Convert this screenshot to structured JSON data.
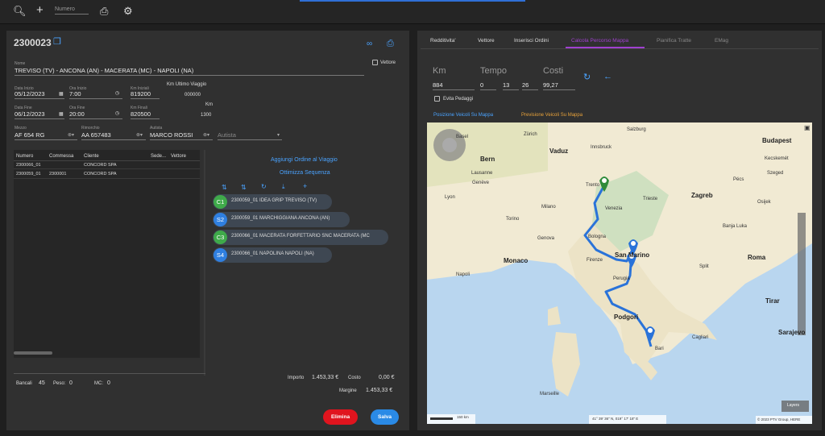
{
  "toolbar": {
    "search_icon": "search-icon",
    "add_icon": "plus-icon",
    "numero_placeholder": "Numero",
    "print_icon": "printer-icon",
    "settings_icon": "gear-icon"
  },
  "order": {
    "number": "2300023",
    "nome_label": "Nome",
    "nome_value": "TREVISO (TV) - ANCONA (AN) - MACERATA (MC) - NAPOLI (NA)",
    "vettore_label": "Vettore",
    "data_inizio_label": "Data Inizio",
    "data_inizio": "05/12/2023",
    "ora_inizio_label": "Ora Inizio",
    "ora_inizio": "7:00",
    "km_iniziali_label": "Km Iniziali",
    "km_iniziali": "819200",
    "km_ultimo_label": "Km Ultimo Viaggio",
    "km_ultimo": "000000",
    "data_fine_label": "Data Fine",
    "data_fine": "06/12/2023",
    "ora_fine_label": "Ora Fine",
    "ora_fine": "20:00",
    "km_finali_label": "Km Finali",
    "km_finali": "820500",
    "km_label": "Km",
    "km_value": "1300",
    "mezzo_label": "Mezzo",
    "mezzo": "AF 654 RG",
    "rimorchio_label": "Rimorchio",
    "rimorchio": "AA 657483",
    "autista_label": "Autista",
    "autista": "MARCO ROSSI",
    "autista2_placeholder": "Autista"
  },
  "table": {
    "headers": [
      "Numero",
      "Commessa",
      "Cliente",
      "Sede...",
      "Vettore"
    ],
    "rows": [
      [
        "2300066_01",
        "",
        "CONCORD SPA"
      ],
      [
        "2300059_01",
        "2300001",
        "CONCORD SPA"
      ]
    ]
  },
  "actions": {
    "aggiungi": "Aggiungi Ordine al Viaggio",
    "ottimizza": "Ottimizza Sequenza"
  },
  "stops": [
    {
      "code": "C1",
      "color": "#3faa4a",
      "text": "2300059_01 IDEA GRIP  TREVISO (TV)"
    },
    {
      "code": "S2",
      "color": "#2f7fe0",
      "text": "2300059_01 MARCHIGGIANA  ANCONA (AN)"
    },
    {
      "code": "C3",
      "color": "#3faa4a",
      "text": "2300066_01 MACERATA FORFETTARIO SNC  MACERATA (MC"
    },
    {
      "code": "S4",
      "color": "#2f7fe0",
      "text": "2300066_01 NAPOLINA  NAPOLI (NA)"
    }
  ],
  "footer": {
    "bancali_label": "Bancali",
    "bancali": "45",
    "peso_label": "Peso:",
    "peso": "0",
    "mc_label": "MC:",
    "mc": "0",
    "importo_label": "Importo",
    "importo": "1.453,33 €",
    "costo_label": "Costo",
    "costo": "0,00 €",
    "margine_label": "Margine",
    "margine": "1.453,33 €",
    "elimina": "Elimina",
    "salva": "Salva"
  },
  "tabs": [
    "Redditivita'",
    "Vettore",
    "Inserisci Ordini",
    "Calcola Percorso Mappa",
    "Pianifica Tratte",
    "EMag"
  ],
  "route": {
    "km_label": "Km",
    "tempo_label": "Tempo",
    "costi_label": "Costi",
    "km": "884",
    "days": "0",
    "hours": "13",
    "minutes": "26",
    "costi": "99,27",
    "evita_pedaggi": "Evita Pedaggi",
    "posizione_link": "Posizione Veicoli Su Mappa",
    "previsione_link": "Previsione Veicoli Su Mappa"
  },
  "map": {
    "cities_major": [
      "Bern",
      "Vaduz",
      "Budapest",
      "Zagreb",
      "Sarajevo",
      "Monaco",
      "Roma",
      "Podgori",
      "Tirar",
      "San Marino"
    ],
    "cities_minor": [
      "Basel",
      "Zürich",
      "Salzburg",
      "Innsbruck",
      "Lausanne",
      "Genève",
      "Lyon",
      "Milano",
      "Torino",
      "Genova",
      "Venezia",
      "Trieste",
      "Bologna",
      "Firenze",
      "Perugia",
      "Marseille",
      "Napoli",
      "Bari",
      "Cagliari",
      "Kecskemét",
      "Szeged",
      "Pécs",
      "Osijek",
      "Banja Luka",
      "Split",
      "Trento"
    ],
    "scale": "150 km",
    "coords": "41° 39' 36\" N, 019° 17' 18\" E",
    "copyright": "© 2023 PTV Group, HERE",
    "layers": "Layers"
  }
}
